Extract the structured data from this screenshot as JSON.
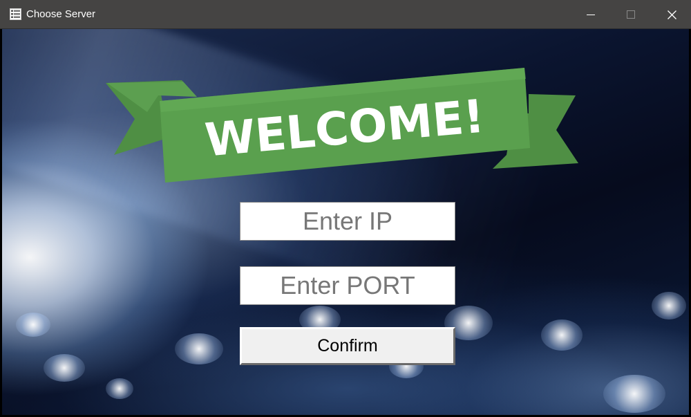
{
  "window": {
    "title": "Choose Server",
    "icon": "server-list-icon",
    "controls": [
      "minimize-icon",
      "maximize-icon",
      "close-icon"
    ]
  },
  "banner": {
    "text": "WELCOME!",
    "color": "#5a9e4d"
  },
  "form": {
    "ip_placeholder": "Enter IP",
    "ip_value": "",
    "port_placeholder": "Enter PORT",
    "port_value": "",
    "confirm_label": "Confirm"
  }
}
